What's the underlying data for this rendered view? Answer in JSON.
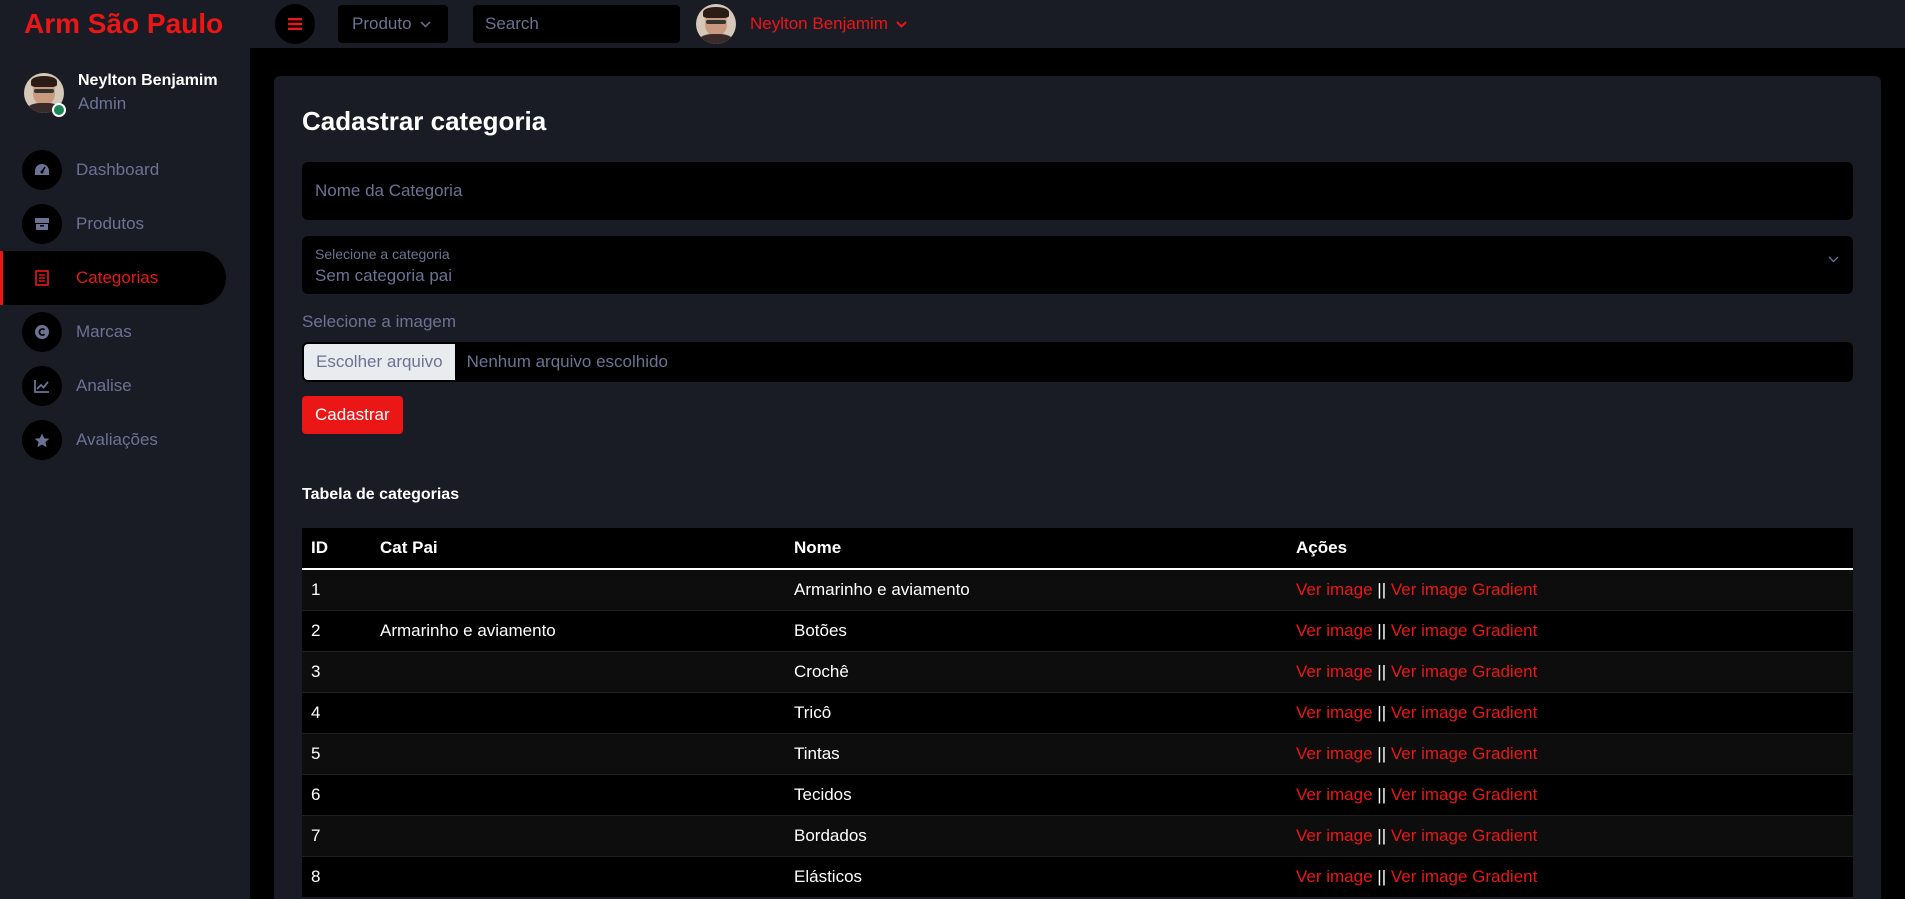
{
  "app": {
    "brand": "Arm São Paulo",
    "accent_color": "#eb1616"
  },
  "topbar": {
    "menu_icon": "bars-icon",
    "produto_label": "Produto",
    "search_placeholder": "Search",
    "user_name": "Neylton Benjamim"
  },
  "sidebar": {
    "user": {
      "name": "Neylton Benjamim",
      "role": "Admin",
      "status": "online"
    },
    "items": [
      {
        "label": "Dashboard",
        "icon": "tachometer-icon",
        "active": false
      },
      {
        "label": "Produtos",
        "icon": "box-icon",
        "active": false
      },
      {
        "label": "Categorias",
        "icon": "list-icon",
        "active": true
      },
      {
        "label": "Marcas",
        "icon": "copyright-icon",
        "active": false
      },
      {
        "label": "Analise",
        "icon": "chart-line-icon",
        "active": false
      },
      {
        "label": "Avaliações",
        "icon": "star-icon",
        "active": false
      }
    ]
  },
  "form": {
    "title": "Cadastrar categoria",
    "name_placeholder": "Nome da Categoria",
    "parent_label": "Selecione a categoria",
    "parent_value": "Sem categoria pai",
    "image_label": "Selecione a imagem",
    "file_button": "Escolher arquivo",
    "file_status": "Nenhum arquivo escolhido",
    "submit": "Cadastrar"
  },
  "table": {
    "title": "Tabela de categorias",
    "headers": [
      "ID",
      "Cat Pai",
      "Nome",
      "Ações"
    ],
    "action_image": "Ver image",
    "action_separator": "||",
    "action_gradient": "Ver image Gradient",
    "rows": [
      {
        "id": "1",
        "pai": "",
        "nome": "Armarinho e aviamento"
      },
      {
        "id": "2",
        "pai": "Armarinho e aviamento",
        "nome": "Botões"
      },
      {
        "id": "3",
        "pai": "",
        "nome": "Crochê"
      },
      {
        "id": "4",
        "pai": "",
        "nome": "Tricô"
      },
      {
        "id": "5",
        "pai": "",
        "nome": "Tintas"
      },
      {
        "id": "6",
        "pai": "",
        "nome": "Tecidos"
      },
      {
        "id": "7",
        "pai": "",
        "nome": "Bordados"
      },
      {
        "id": "8",
        "pai": "",
        "nome": "Elásticos"
      }
    ]
  }
}
